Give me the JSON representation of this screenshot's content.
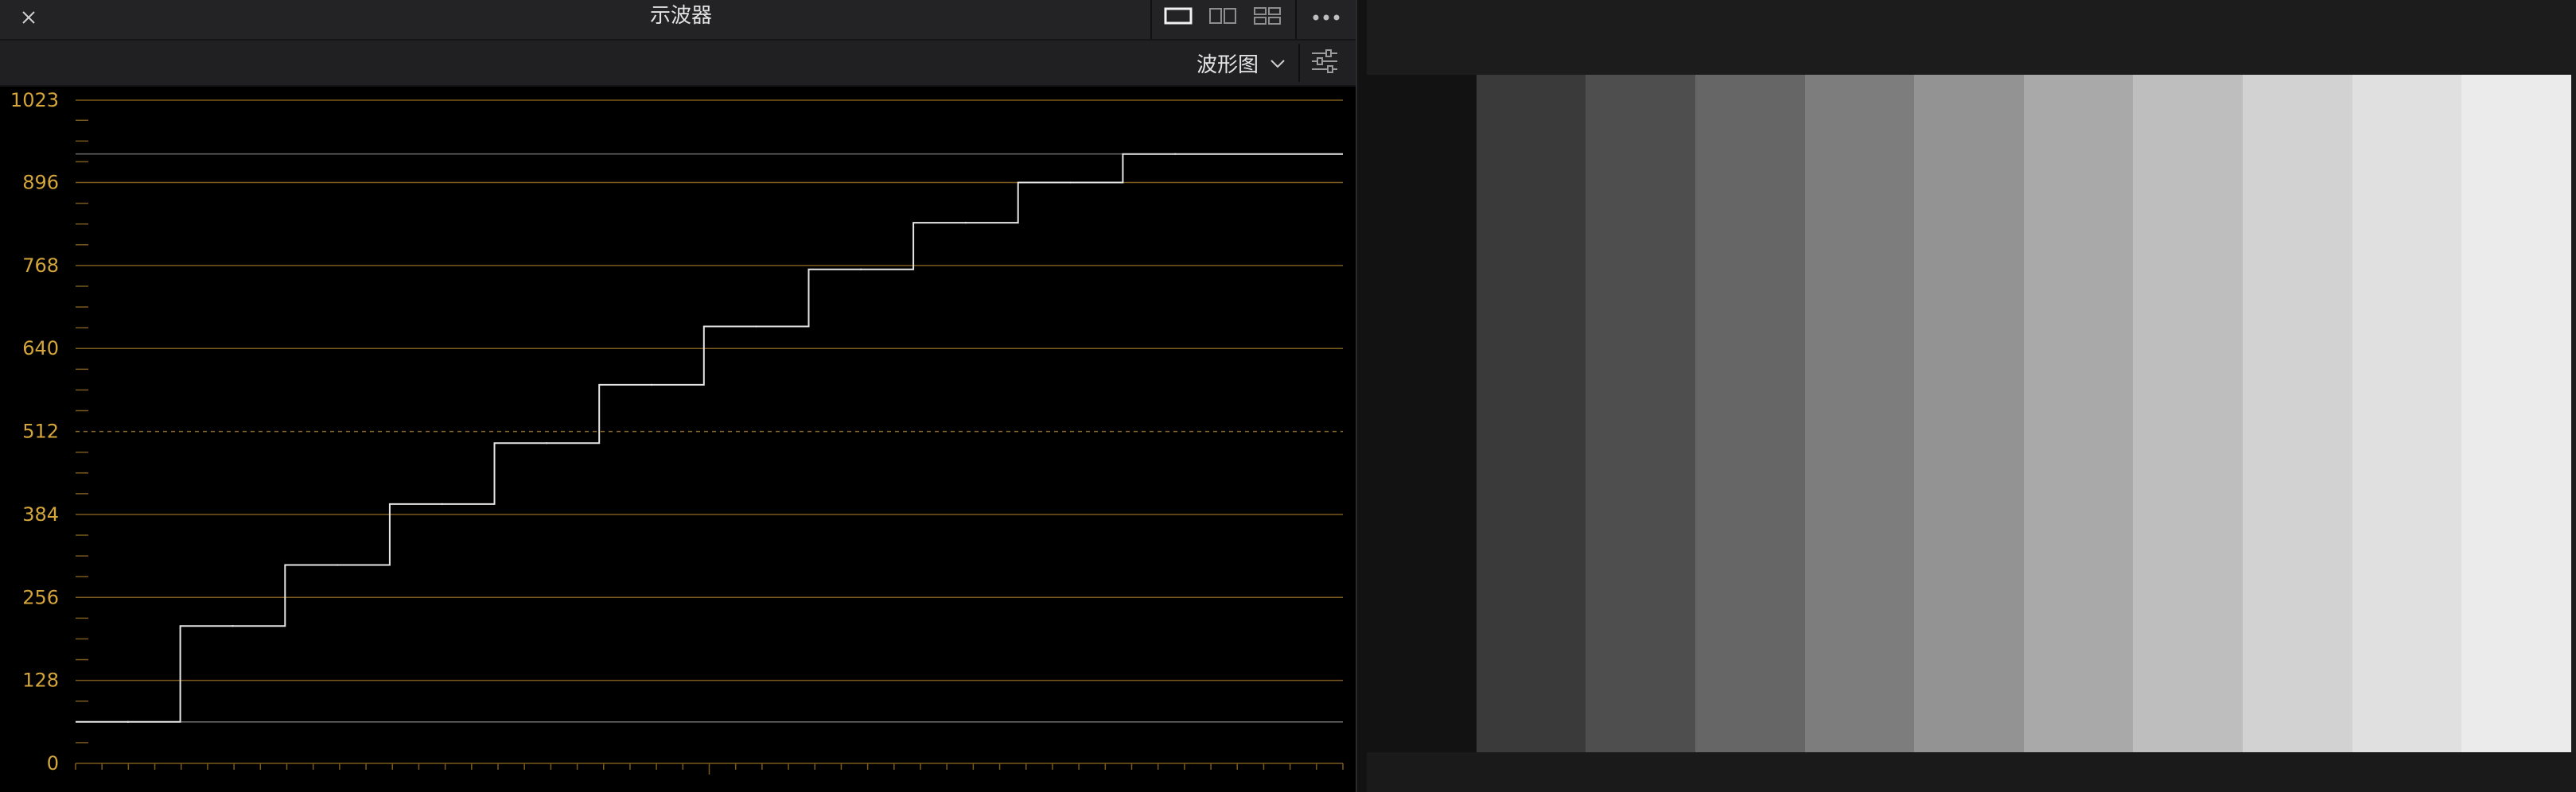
{
  "window": {
    "title": "示波器"
  },
  "toolbar": {
    "scope_type": "波形图"
  },
  "colors": {
    "axis_label": "#d4a53a",
    "gridline": "#7a5a1e",
    "trace": "#e6e6e6",
    "panel_bg": "#000000"
  },
  "icons": {
    "close": "close-icon",
    "single_layout": "single-view-layout-icon",
    "dual_layout": "dual-view-layout-icon",
    "quad_layout": "quad-view-layout-icon",
    "more": "more-options-icon",
    "dropdown": "chevron-down-icon",
    "settings": "sliders-settings-icon"
  },
  "chart_data": {
    "type": "line",
    "title": "",
    "xlabel": "",
    "ylabel": "",
    "ylim": [
      0,
      1023
    ],
    "yticks": [
      0,
      128,
      256,
      384,
      512,
      640,
      768,
      896,
      1023
    ],
    "ytick_labels": [
      "0",
      "128",
      "256",
      "384",
      "512",
      "640",
      "768",
      "896",
      "1023"
    ],
    "dashed_reference": 512,
    "reference_lines": [
      64,
      940
    ],
    "x": [
      0,
      1,
      2,
      3,
      4,
      5,
      6,
      7,
      8,
      9,
      10
    ],
    "series": [
      {
        "values": [
          64,
          212,
          306,
          400,
          494,
          584,
          674,
          762,
          834,
          896,
          940
        ]
      }
    ]
  },
  "viewer": {
    "swatch_colors": [
      "#121212",
      "#3a3a3a",
      "#4e4e4e",
      "#666666",
      "#7d7d7d",
      "#939393",
      "#a9a9a9",
      "#bebebe",
      "#d2d2d2",
      "#e0e0e0",
      "#ebebeb"
    ]
  }
}
